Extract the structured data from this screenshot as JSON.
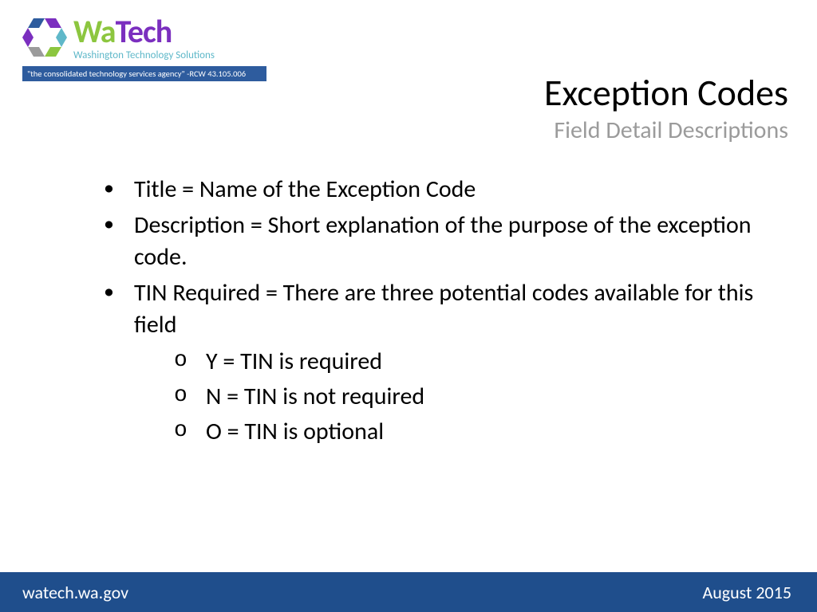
{
  "logo": {
    "wa": "Wa",
    "tech": "Tech",
    "subtitle": "Washington Technology Solutions",
    "banner": "\"the consolidated technology services agency\" -RCW 43.105.006"
  },
  "heading": {
    "title": "Exception Codes",
    "subtitle": "Field Detail Descriptions"
  },
  "bullets": {
    "item1": "Title = Name of the Exception Code",
    "item2": "Description = Short explanation of the purpose of the exception code.",
    "item3": "TIN Required = There are three potential codes available for this field",
    "sub1": "Y = TIN is required",
    "sub2": "N = TIN is not required",
    "sub3": "O = TIN is optional"
  },
  "footer": {
    "left": "watech.wa.gov",
    "right": "August 2015"
  }
}
